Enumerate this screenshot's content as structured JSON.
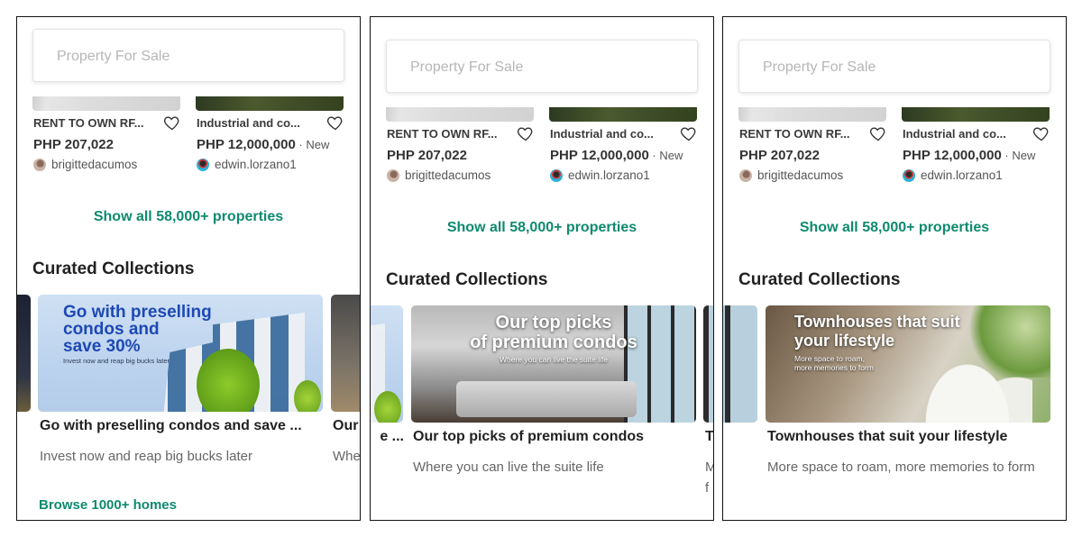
{
  "search": {
    "placeholder": "Property For Sale"
  },
  "listings": [
    {
      "title": "RENT TO OWN RF...",
      "price": "PHP 207,022",
      "badge": "",
      "seller": "brigittedacumos",
      "favorite_icon": "heart-outline-icon"
    },
    {
      "title": "Industrial and co...",
      "price": "PHP 12,000,000",
      "badge": " · New",
      "seller": "edwin.lorzano1",
      "favorite_icon": "heart-outline-icon"
    }
  ],
  "show_all_label": "Show all 58,000+ properties",
  "section_title": "Curated Collections",
  "collections": [
    {
      "banner_heading": "Go with preselling condos and save 30%",
      "banner_heading_lines": [
        "Go with preselling",
        "condos and",
        "save 30%"
      ],
      "banner_subheading": "Invest now and reap big bucks later",
      "title": "Go with preselling condos and save ...",
      "subtitle": "Invest now and reap big bucks later",
      "browse_label": "Browse 1000+ homes",
      "accent": "#1d49b4"
    },
    {
      "banner_heading_lines": [
        "Our top picks",
        "of premium condos"
      ],
      "banner_subheading": "Where you can live the suite life",
      "title": "Our top picks of premium condos",
      "subtitle": "Where you can live the suite life"
    },
    {
      "banner_heading_lines": [
        "Townhouses that suit",
        "your lifestyle"
      ],
      "banner_subheading_lines": [
        "More space to roam,",
        "more memories to form"
      ],
      "title": "Townhouses that suit your lifestyle",
      "subtitle": "More space to roam, more memories to form"
    }
  ],
  "peek_text": {
    "panel1_next_title": "Our",
    "panel1_next_subtitle": "Whe",
    "panel2_prev_title": "e ...",
    "panel2_next_title": "T",
    "panel2_next_subtitle": "M",
    "panel2_next_subtitle_2": "f"
  },
  "colors": {
    "accent_green": "#0e8a6e",
    "text_dark": "#222222",
    "text_muted": "#666666",
    "placeholder": "#b6b6b6"
  }
}
